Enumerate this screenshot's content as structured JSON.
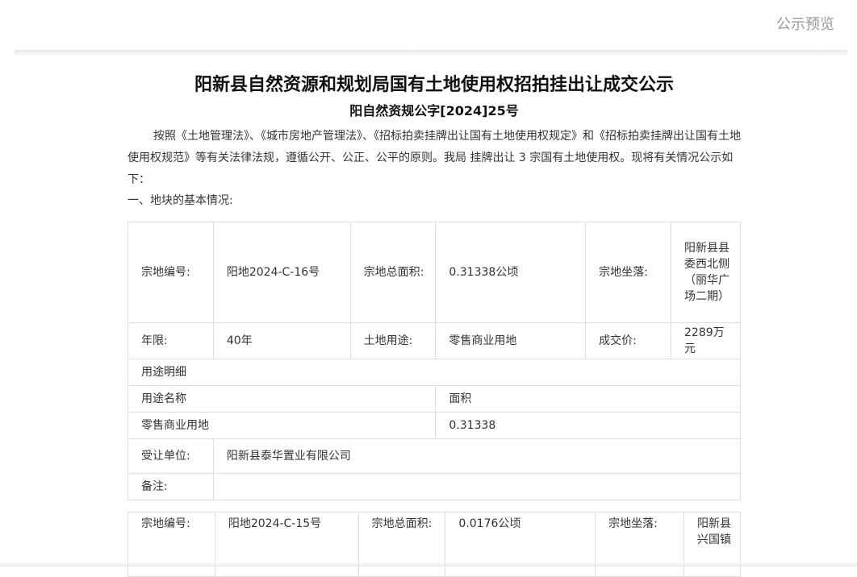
{
  "header": {
    "preview_label": "公示预览"
  },
  "doc": {
    "title": "阳新县自然资源和规划局国有土地使用权招拍挂出让成交公示",
    "doc_no": "阳自然资规公字[2024]25号",
    "intro": "按照《土地管理法》、《城市房地产管理法》、《招标拍卖挂牌出让国有土地使用权规定》和《招标拍卖挂牌出让国有土地使用权规范》等有关法律法规，遵循公开、公正、公平的原则。我局 挂牌出让 3 宗国有土地使用权。现将有关情况公示如下：",
    "section1": "一、地块的基本情况:"
  },
  "labels": {
    "parcel_no": "宗地编号:",
    "total_area": "宗地总面积:",
    "location": "宗地坐落:",
    "term": "年限:",
    "land_use": "土地用途:",
    "price": "成交价:",
    "use_detail": "用途明细",
    "use_name": "用途名称",
    "area": "面积",
    "transferee": "受让单位:",
    "remarks": "备注:"
  },
  "parcels": [
    {
      "parcel_no": "阳地2024-C-16号",
      "total_area": "0.31338公顷",
      "location": "阳新县县委西北侧（丽华广场二期）",
      "term": "40年",
      "land_use": "零售商业用地",
      "price": "2289万元",
      "use_name": "零售商业用地",
      "use_area": "0.31338",
      "transferee": "阳新县泰华置业有限公司",
      "remarks": ""
    },
    {
      "parcel_no": "阳地2024-C-15号",
      "total_area": "0.0176公顷",
      "location": "阳新县兴国镇"
    }
  ]
}
